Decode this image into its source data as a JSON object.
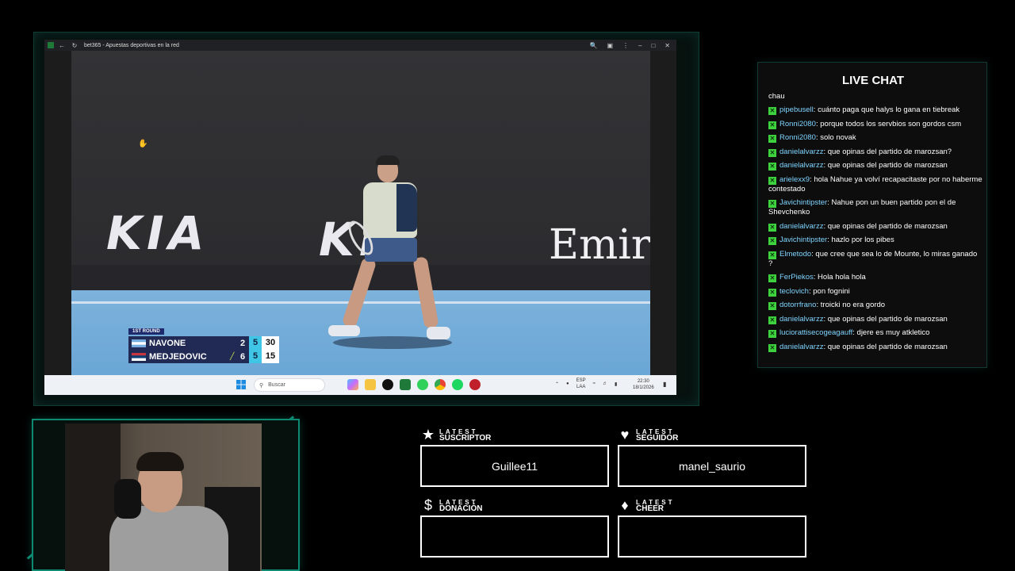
{
  "browser": {
    "title": "bet365 - Apuestas deportivas en la red"
  },
  "scoreboard": {
    "round": "1ST ROUND",
    "players": [
      {
        "name": "NAVONE",
        "sets": "2",
        "games": "5",
        "points": "30",
        "serving": false
      },
      {
        "name": "MEDJEDOVIC",
        "sets": "6",
        "games": "5",
        "points": "15",
        "serving": true
      }
    ]
  },
  "sponsors": {
    "banner1": "KIA",
    "banner2": "KIA",
    "banner3": "Emira"
  },
  "taskbar": {
    "search_placeholder": "Buscar",
    "lang_top": "ESP",
    "lang_bottom": "LAA",
    "time": "22:30",
    "date": "18/1/2026"
  },
  "chat": {
    "title": "LIVE CHAT",
    "first_line": "chau",
    "messages": [
      {
        "user": "pipebusell",
        "text": "cuánto paga que halys lo gana en tiebreak"
      },
      {
        "user": "Ronni2080",
        "text": "porque todos los servbios son gordos csm"
      },
      {
        "user": "Ronni2080",
        "text": "solo novak"
      },
      {
        "user": "danielalvarzz",
        "text": "que opinas del partido de marozsan?"
      },
      {
        "user": "danielalvarzz",
        "text": "que opinas del partido de marozsan"
      },
      {
        "user": "arielexx9",
        "text": "hola Nahue ya volví recapacitaste por no haberme contestado"
      },
      {
        "user": "Javichintipster",
        "text": "Nahue pon un buen partido pon el de Shevchenko"
      },
      {
        "user": "danielalvarzz",
        "text": "que opinas del partido de marozsan"
      },
      {
        "user": "Javichintipster",
        "text": "hazlo por los pibes"
      },
      {
        "user": "Elmetodo",
        "text": "que cree que sea lo de Mounte, lo miras ganado ?"
      },
      {
        "user": "FerPiekos",
        "text": "Hola hola hola"
      },
      {
        "user": "teclovich",
        "text": "pon fognini"
      },
      {
        "user": "dotorrfrano",
        "text": "troicki no era gordo"
      },
      {
        "user": "danielalvarzz",
        "text": "que opinas del partido de marozsan"
      },
      {
        "user": "luciorattisecogeagauff",
        "text": "djere es muy atkletico"
      },
      {
        "user": "danielalvarzz",
        "text": "que opinas del partido de marozsan"
      }
    ]
  },
  "widgets": {
    "suscriptor": {
      "small": "LATEST",
      "big": "SUSCRIPTOR",
      "value": "Guillee11",
      "icon": "star-icon"
    },
    "seguidor": {
      "small": "LATEST",
      "big": "SEGUIDOR",
      "value": "manel_saurio",
      "icon": "heart-icon"
    },
    "donacion": {
      "small": "LATEST",
      "big": "DONACIÓN",
      "value": "",
      "icon": "dollar-icon"
    },
    "cheer": {
      "small": "LATEST",
      "big": "CHEER",
      "value": "",
      "icon": "diamond-icon"
    }
  },
  "colors": {
    "accent": "#0d8a73",
    "chat_user": "#7fd4ff",
    "badge": "#3ed23e"
  }
}
